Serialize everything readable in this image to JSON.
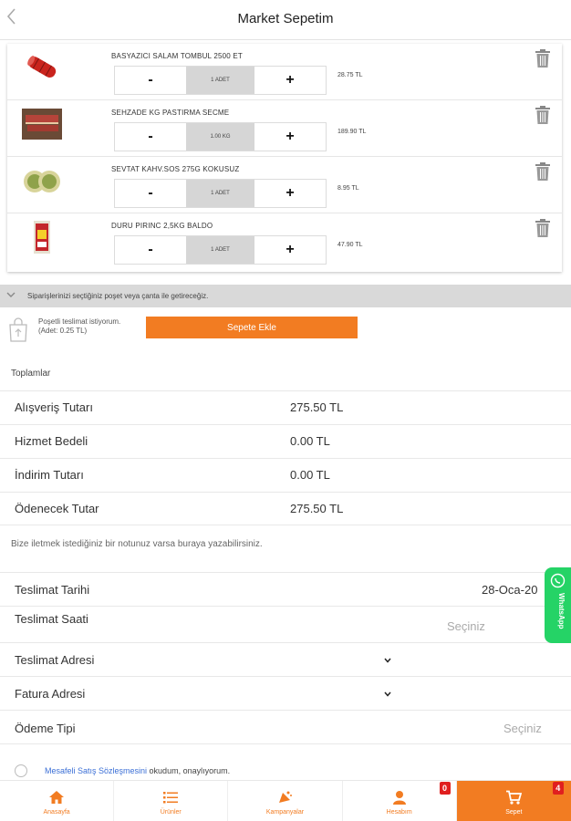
{
  "header": {
    "title": "Market Sepetim",
    "back_icon": "chevron-left-icon"
  },
  "colors": {
    "accent": "#f27c22",
    "badge": "#e01f1f",
    "whatsapp": "#25d366",
    "link": "#3b6fd6"
  },
  "cart": {
    "items": [
      {
        "name": "BASYAZICI SALAM TOMBUL 2500 ET",
        "qty": "1 ADET",
        "price": "28.75 TL",
        "minus": "-",
        "plus": "+"
      },
      {
        "name": "SEHZADE KG PASTIRMA SECME",
        "qty": "1.00 KG",
        "price": "189.90 TL",
        "minus": "-",
        "plus": "+"
      },
      {
        "name": "SEVTAT KAHV.SOS 275G KOKUSUZ",
        "qty": "1 ADET",
        "price": "8.95 TL",
        "minus": "-",
        "plus": "+"
      },
      {
        "name": "DURU PIRINC 2,5KG BALDO",
        "qty": "1 ADET",
        "price": "47.90 TL",
        "minus": "-",
        "plus": "+"
      }
    ]
  },
  "notice": {
    "text": "Siparişlerinizi seçtiğiniz poşet veya çanta ile getireceğiz."
  },
  "bag": {
    "line1": "Poşetli teslimat istiyorum.",
    "line2": "(Adet: 0.25 TL)",
    "button": "Sepete Ekle"
  },
  "totals": {
    "heading": "Toplamlar",
    "rows": [
      {
        "label": "Alışveriş Tutarı",
        "value": "275.50 TL"
      },
      {
        "label": "Hizmet Bedeli",
        "value": "0.00 TL"
      },
      {
        "label": "İndirim Tutarı",
        "value": "0.00 TL"
      },
      {
        "label": "Ödenecek Tutar",
        "value": "275.50 TL"
      }
    ]
  },
  "note": {
    "placeholder": "Bize iletmek istediğiniz bir notunuz varsa buraya yazabilirsiniz."
  },
  "delivery": {
    "date_label": "Teslimat Tarihi",
    "date_value": "28-Oca-20",
    "time_label": "Teslimat Saati",
    "time_placeholder": "Seçiniz",
    "address_label": "Teslimat Adresi",
    "invoice_label": "Fatura Adresi",
    "payment_label": "Ödeme Tipi",
    "payment_placeholder": "Seçiniz"
  },
  "whatsapp": {
    "label": "WhatsApp"
  },
  "agreement": {
    "link": "Mesafeli Satış Sözleşmesini",
    "rest": " okudum, onaylıyorum."
  },
  "nav": {
    "items": [
      {
        "label": "Anasayfa",
        "icon": "home-icon"
      },
      {
        "label": "Ürünler",
        "icon": "list-icon"
      },
      {
        "label": "Kampanyalar",
        "icon": "campaign-icon"
      },
      {
        "label": "Hesabım",
        "icon": "user-icon",
        "badge": "0"
      },
      {
        "label": "Sepet",
        "icon": "cart-icon",
        "badge": "4"
      }
    ]
  }
}
